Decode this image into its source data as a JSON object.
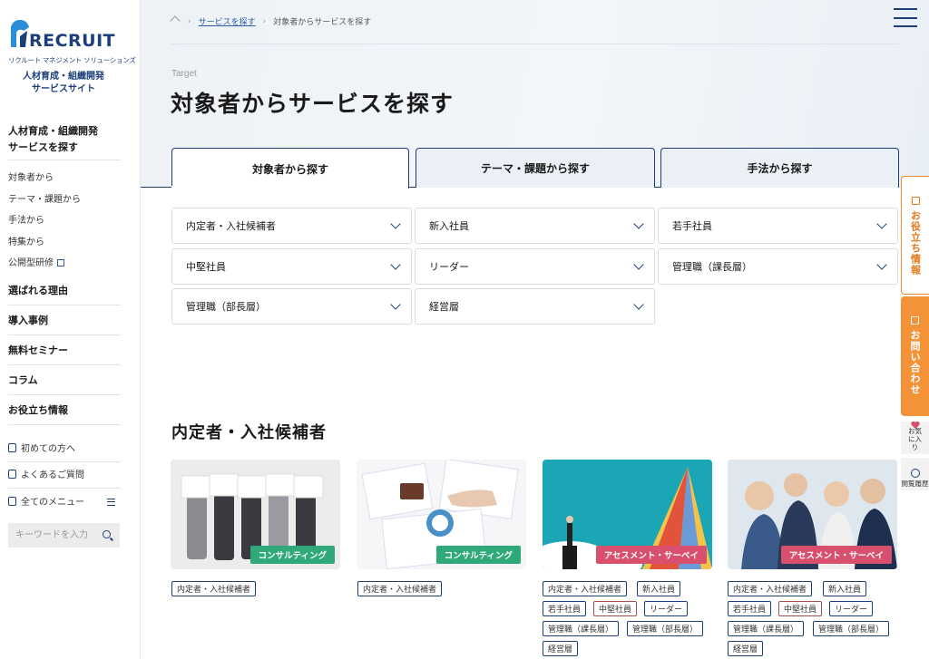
{
  "brand": {
    "logo_word": "RECRUIT",
    "logo_sub": "リクルート マネジメント ソリューションズ",
    "site_line1": "人材育成・組織開発",
    "site_line2": "サービスサイト",
    "color": "#1c3f7a"
  },
  "sidebar": {
    "head_line1": "人材育成・組織開発",
    "head_line2": "サービスを探す",
    "sub_items": [
      {
        "label": "対象者から"
      },
      {
        "label": "テーマ・課題から"
      },
      {
        "label": "手法から"
      },
      {
        "label": "特集から"
      },
      {
        "label": "公開型研修"
      }
    ],
    "main_items": [
      {
        "label": "選ばれる理由"
      },
      {
        "label": "導入事例"
      },
      {
        "label": "無料セミナー"
      },
      {
        "label": "コラム"
      },
      {
        "label": "お役立ち情報"
      }
    ],
    "util_items": [
      {
        "label": "初めての方へ"
      },
      {
        "label": "よくあるご質問"
      },
      {
        "label": "全てのメニュー"
      }
    ],
    "search_placeholder": "キーワードを入力"
  },
  "breadcrumb": {
    "link": "サービスを探す",
    "current": "対象者からサービスを探す"
  },
  "hero": {
    "eyebrow": "Target",
    "title": "対象者からサービスを探す"
  },
  "tabs": [
    {
      "label": "対象者から探す",
      "active": true
    },
    {
      "label": "テーマ・課題から探す",
      "active": false
    },
    {
      "label": "手法から探す",
      "active": false
    }
  ],
  "targets": [
    {
      "label": "内定者・入社候補者"
    },
    {
      "label": "新入社員"
    },
    {
      "label": "若手社員"
    },
    {
      "label": "中堅社員"
    },
    {
      "label": "リーダー"
    },
    {
      "label": "管理職（課長層）"
    },
    {
      "label": "管理職（部長層）"
    },
    {
      "label": "経営層"
    }
  ],
  "section": {
    "title": "内定者・入社候補者"
  },
  "cards": [
    {
      "badge": "コンサルティング",
      "badge_color": "#2fa87a",
      "tags": [
        "内定者・入社候補者"
      ]
    },
    {
      "badge": "コンサルティング",
      "badge_color": "#2fa87a",
      "tags": [
        "内定者・入社候補者"
      ]
    },
    {
      "badge": "アセスメント・サーベイ",
      "badge_color": "#d9506f",
      "tags": [
        "内定者・入社候補者",
        "新入社員",
        "若手社員",
        "中堅社員",
        "リーダー",
        "管理職（課長層）",
        "管理職（部長層）",
        "経営層"
      ]
    },
    {
      "badge": "アセスメント・サーベイ",
      "badge_color": "#d9506f",
      "tags": [
        "内定者・入社候補者",
        "新入社員",
        "若手社員",
        "中堅社員",
        "リーダー",
        "管理職（課長層）",
        "管理職（部長層）",
        "経営層"
      ]
    }
  ],
  "floating": {
    "useful_info": "お役立ち情報",
    "contact": "お問い合わせ",
    "favorite": "お気に入り",
    "history": "閲覧履歴",
    "accent": "#f39237"
  }
}
